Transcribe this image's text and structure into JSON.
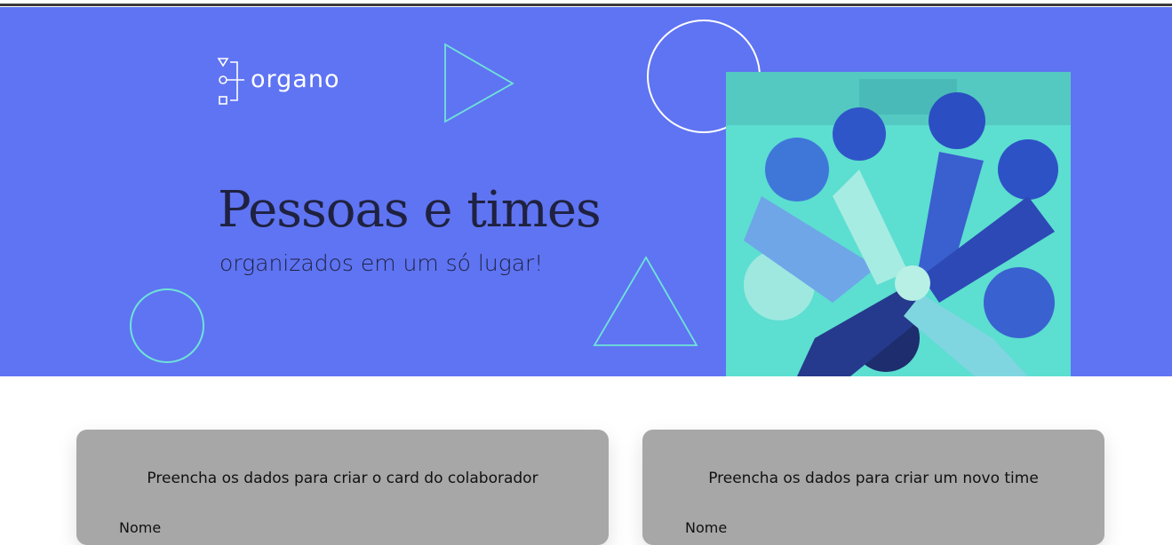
{
  "brand": {
    "name": "organo"
  },
  "hero": {
    "title": "Pessoas e times",
    "subtitle": "organizados em um só lugar!"
  },
  "photo": {
    "alt": "Grupo de pessoas unindo as mãos",
    "tint": "#59e1cf"
  },
  "colors": {
    "banner": "#5f74f2",
    "text_dark": "#1f2140",
    "shape_aqua": "#6fe3d8",
    "card_bg": "#a7a7a7"
  },
  "forms": {
    "collaborator": {
      "title": "Preencha os dados para criar o card do colaborador",
      "name_label": "Nome"
    },
    "team": {
      "title": "Preencha os dados para criar um novo time",
      "name_label": "Nome"
    }
  }
}
